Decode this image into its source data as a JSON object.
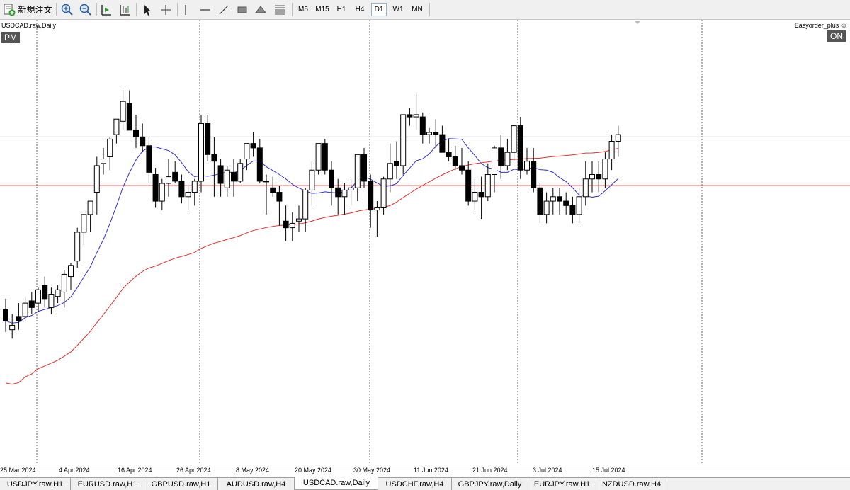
{
  "toolbar": {
    "new_order_label": "新規注文",
    "timeframes": [
      "M5",
      "M15",
      "H1",
      "H4",
      "D1",
      "W1",
      "MN"
    ],
    "active_timeframe": "D1"
  },
  "chart": {
    "symbol_label": "USDCAD.raw,Daily",
    "pm_badge": "PM",
    "ea_label": "Easyorder_plus ☺",
    "on_badge": "ON",
    "ma_short_color": "#3333cc",
    "ma_long_color": "#e03030",
    "hline_color": "#d04040"
  },
  "chart_data": {
    "type": "candlestick",
    "x_tick_labels": [
      "25 Mar 2024",
      "4 Apr 2024",
      "16 Apr 2024",
      "26 Apr 2024",
      "8 May 2024",
      "20 May 2024",
      "30 May 2024",
      "11 Jun 2024",
      "21 Jun 2024",
      "3 Jul 2024",
      "15 Jul 2024"
    ],
    "candles": [
      [
        57,
        62,
        47,
        52
      ],
      [
        48,
        55,
        44,
        50
      ],
      [
        54,
        60,
        48,
        52
      ],
      [
        54,
        63,
        52,
        60
      ],
      [
        61,
        65,
        55,
        58
      ],
      [
        60,
        67,
        56,
        66
      ],
      [
        68,
        72,
        58,
        62
      ],
      [
        58,
        67,
        55,
        64
      ],
      [
        63,
        68,
        60,
        66
      ],
      [
        65,
        75,
        58,
        73
      ],
      [
        72,
        78,
        66,
        77
      ],
      [
        79,
        94,
        76,
        92
      ],
      [
        92,
        100,
        86,
        100
      ],
      [
        100,
        103,
        92,
        106
      ],
      [
        110,
        126,
        100,
        122
      ],
      [
        123,
        130,
        118,
        125
      ],
      [
        126,
        135,
        120,
        134
      ],
      [
        136,
        143,
        132,
        143
      ],
      [
        142,
        156,
        138,
        151
      ],
      [
        150,
        156,
        142,
        138
      ],
      [
        138,
        145,
        130,
        135
      ],
      [
        135,
        141,
        128,
        131
      ],
      [
        131,
        135,
        114,
        119
      ],
      [
        118,
        121,
        103,
        106
      ],
      [
        106,
        116,
        102,
        114
      ],
      [
        114,
        125,
        108,
        117
      ],
      [
        119,
        124,
        114,
        115
      ],
      [
        115,
        118,
        105,
        108
      ],
      [
        108,
        113,
        102,
        110
      ],
      [
        110,
        116,
        104,
        115
      ],
      [
        115,
        145,
        110,
        141
      ],
      [
        141,
        145,
        124,
        127
      ],
      [
        127,
        135,
        108,
        124
      ],
      [
        122,
        125,
        108,
        114
      ],
      [
        112,
        122,
        108,
        120
      ],
      [
        119,
        125,
        108,
        115
      ],
      [
        115,
        125,
        114,
        123
      ],
      [
        125,
        132,
        120,
        132
      ],
      [
        132,
        137,
        126,
        130
      ],
      [
        130,
        134,
        114,
        115
      ],
      [
        115,
        118,
        100,
        115
      ],
      [
        112,
        117,
        108,
        110
      ],
      [
        110,
        113,
        95,
        106
      ],
      [
        97,
        104,
        88,
        94
      ],
      [
        94,
        101,
        88,
        96
      ],
      [
        97,
        104,
        92,
        98
      ],
      [
        98,
        112,
        92,
        111
      ],
      [
        111,
        124,
        104,
        120
      ],
      [
        120,
        130,
        118,
        132
      ],
      [
        132,
        134,
        118,
        120
      ],
      [
        120,
        124,
        104,
        112
      ],
      [
        112,
        116,
        100,
        108
      ],
      [
        108,
        114,
        100,
        111
      ],
      [
        111,
        116,
        104,
        112
      ],
      [
        112,
        126,
        106,
        127
      ],
      [
        127,
        130,
        112,
        115
      ],
      [
        115,
        118,
        94,
        102
      ],
      [
        102,
        106,
        90,
        103
      ],
      [
        103,
        117,
        100,
        116
      ],
      [
        116,
        132,
        110,
        123
      ],
      [
        124,
        133,
        116,
        122
      ],
      [
        122,
        145,
        118,
        145
      ],
      [
        145,
        148,
        140,
        144
      ],
      [
        144,
        155,
        138,
        145
      ],
      [
        144,
        146,
        132,
        136
      ],
      [
        136,
        139,
        132,
        137
      ],
      [
        137,
        143,
        130,
        136
      ],
      [
        136,
        140,
        128,
        128
      ],
      [
        128,
        134,
        124,
        126
      ],
      [
        126,
        131,
        120,
        122
      ],
      [
        122,
        130,
        118,
        120
      ],
      [
        120,
        124,
        104,
        106
      ],
      [
        106,
        116,
        102,
        110
      ],
      [
        110,
        117,
        98,
        108
      ],
      [
        108,
        123,
        106,
        118
      ],
      [
        118,
        131,
        110,
        130
      ],
      [
        130,
        136,
        116,
        122
      ],
      [
        122,
        134,
        120,
        128
      ],
      [
        128,
        140,
        124,
        140
      ],
      [
        140,
        144,
        116,
        120
      ],
      [
        120,
        130,
        118,
        124
      ],
      [
        124,
        130,
        110,
        112
      ],
      [
        112,
        114,
        96,
        100
      ],
      [
        100,
        110,
        96,
        106
      ],
      [
        106,
        112,
        100,
        108
      ],
      [
        108,
        112,
        100,
        106
      ],
      [
        106,
        110,
        100,
        104
      ],
      [
        104,
        108,
        96,
        100
      ],
      [
        100,
        112,
        96,
        108
      ],
      [
        108,
        124,
        104,
        116
      ],
      [
        116,
        124,
        110,
        118
      ],
      [
        118,
        124,
        110,
        116
      ],
      [
        116,
        128,
        112,
        125
      ],
      [
        125,
        136,
        120,
        133
      ],
      [
        133,
        140,
        126,
        136
      ]
    ],
    "horizontal_line_level": 113.0,
    "last_price_level": 135.0
  },
  "tabs": [
    "USDJPY.raw,H1",
    "EURUSD.raw,H1",
    "GBPUSD.raw,H1",
    "AUDUSD.raw,H4",
    "USDCAD.raw,Daily",
    "USDCHF.raw,H4",
    "GBPJPY.raw,Daily",
    "EURJPY.raw,H1",
    "NZDUSD.raw,H4"
  ],
  "active_tab": "USDCAD.raw,Daily"
}
